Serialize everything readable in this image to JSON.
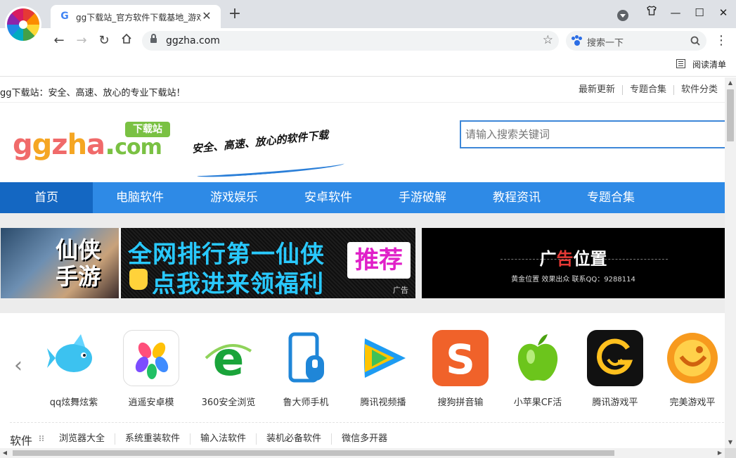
{
  "browser": {
    "tab_title": "gg下载站_官方软件下载基地_游戏",
    "tab_favicon": "G",
    "url": "ggzha.com",
    "search_placeholder": "搜索一下",
    "reading_list": "阅读清单",
    "icons": {
      "back": "back-arrow-icon",
      "forward": "forward-arrow-icon",
      "reload": "reload-icon",
      "home": "home-icon",
      "lock": "lock-icon",
      "star": "star-icon",
      "menu": "kebab-menu-icon"
    }
  },
  "site": {
    "tagline": "gg下载站：安全、高速、放心的专业下载站！",
    "top_links": [
      "最新更新",
      "专题合集",
      "软件分类"
    ],
    "logo": {
      "g1": "g",
      "g2": "g",
      "z": "z",
      "h": "h",
      "a": "a",
      "dot": ".",
      "com": "com",
      "badge": "下载站"
    },
    "slogan": "安全、高速、放心的软件下载",
    "search_placeholder": "请输入搜索关键词",
    "nav": [
      {
        "label": "首页",
        "active": true
      },
      {
        "label": "电脑软件"
      },
      {
        "label": "游戏娱乐"
      },
      {
        "label": "安卓软件"
      },
      {
        "label": "手游破解"
      },
      {
        "label": "教程资讯"
      },
      {
        "label": "专题合集"
      }
    ],
    "ad_game": {
      "thumb_text": "仙侠手游",
      "line1": "全网排行第一仙侠",
      "line2": "点我进来领福利",
      "recommend": "推荐",
      "label": "广告"
    },
    "ad_slot": {
      "title_pre": "广",
      "title_red": "告",
      "title_post": "位置",
      "subtitle": "黄金位置 效果出众 联系QQ：9288114"
    },
    "apps": [
      {
        "name": "qq炫舞炫紫",
        "icon": "fish-icon"
      },
      {
        "name": "逍遥安卓模",
        "icon": "flower-icon"
      },
      {
        "name": "360安全浏览",
        "icon": "browser-e-icon"
      },
      {
        "name": "鲁大师手机",
        "icon": "mobile-master-icon"
      },
      {
        "name": "腾讯视频播",
        "icon": "play-icon"
      },
      {
        "name": "搜狗拼音输",
        "icon": "sogou-icon"
      },
      {
        "name": "小苹果CF活",
        "icon": "apple-icon"
      },
      {
        "name": "腾讯游戏平",
        "icon": "game-platform-icon"
      },
      {
        "name": "完美游戏平",
        "icon": "perfect-game-icon"
      }
    ],
    "category": {
      "title": "软件",
      "links": [
        "浏览器大全",
        "系统重装软件",
        "输入法软件",
        "装机必备软件",
        "微信多开器"
      ]
    }
  },
  "colors": {
    "nav_blue": "#2e8ae6",
    "nav_active": "#1467c2",
    "search_border": "#3d87d8",
    "ad_cyan": "#29c9ff",
    "ad_magenta": "#e020c8"
  }
}
